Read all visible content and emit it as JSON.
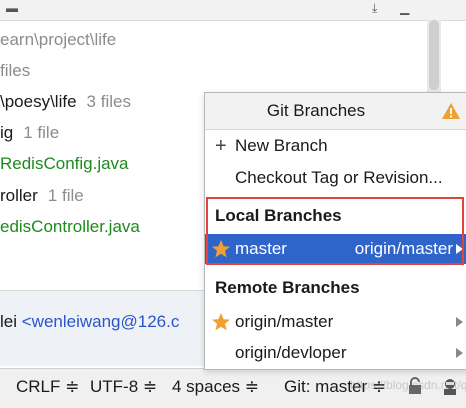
{
  "project_tree": {
    "rows": [
      {
        "path": "earn\\project\\life",
        "count": "",
        "cls": "muted"
      },
      {
        "path": "",
        "count": "files",
        "cls": "muted"
      },
      {
        "path": "\\poesy\\life",
        "count": "3 files",
        "cls": ""
      },
      {
        "path": "ig",
        "count": "1 file",
        "cls": ""
      },
      {
        "path": "RedisConfig.java",
        "count": "",
        "cls": "green"
      },
      {
        "path": "roller",
        "count": "1 file",
        "cls": ""
      },
      {
        "path": "edisController.java",
        "count": "",
        "cls": "green"
      }
    ]
  },
  "commit": {
    "author": "lei",
    "email": "<wenleiwang@126.c"
  },
  "popup": {
    "title": "Git Branches",
    "actions": [
      {
        "label": "New Branch",
        "icon": "plus-icon"
      },
      {
        "label": "Checkout Tag or Revision..."
      }
    ],
    "local_section": "Local Branches",
    "local_branches": [
      {
        "name": "master",
        "tracking": "origin/master",
        "starred": true,
        "selected": true
      }
    ],
    "remote_section": "Remote Branches",
    "remote_branches": [
      {
        "name": "origin/master",
        "starred": true
      },
      {
        "name": "origin/devloper",
        "starred": false
      }
    ]
  },
  "status_bar": {
    "line_sep": "CRLF ≑",
    "encoding": "UTF-8 ≑",
    "indent": "4 spaces ≑",
    "branch": "Git: master ≑",
    "watermark": "https://blog.csdn.net/qq_4213"
  },
  "colors": {
    "selection": "#2f65ca",
    "highlight_border": "#e0443a",
    "star": "#f0a030",
    "warning": "#f0a030"
  }
}
